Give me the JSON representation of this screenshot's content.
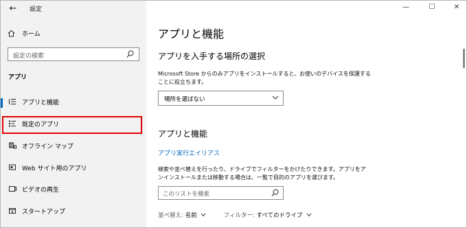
{
  "window": {
    "title": "設定",
    "back_icon": "←",
    "controls": {
      "minimize": "—",
      "maximize": "☐",
      "close": "✕"
    }
  },
  "sidebar": {
    "home": {
      "icon": "home-icon",
      "label": "ホーム"
    },
    "search": {
      "placeholder": "設定の検索"
    },
    "section": "アプリ",
    "items": [
      {
        "icon": "apps-features-icon",
        "label": "アプリと機能",
        "selected": true
      },
      {
        "icon": "default-apps-icon",
        "label": "既定のアプリ",
        "selected": false,
        "highlighted": true
      },
      {
        "icon": "offline-maps-icon",
        "label": "オフライン マップ",
        "selected": false
      },
      {
        "icon": "apps-for-websites-icon",
        "label": "Web サイト用のアプリ",
        "selected": false
      },
      {
        "icon": "video-playback-icon",
        "label": "ビデオの再生",
        "selected": false
      },
      {
        "icon": "startup-icon",
        "label": "スタートアップ",
        "selected": false
      }
    ]
  },
  "main": {
    "page_title": "アプリと機能",
    "install_section": {
      "heading": "アプリを入手する場所の選択",
      "description": "Microsoft Store からのみアプリをインストールすると、お使いのデバイスを保護することに役立ちます。",
      "dropdown_value": "場所を選ばない"
    },
    "features_section": {
      "heading": "アプリと機能",
      "link": "アプリ実行エイリアス",
      "description": "検索や並べ替えを行ったり、ドライブでフィルターをかけたりできます。アプリをアンインストールまたは移動する場合は、一覧で目的のアプリを選びます。",
      "search_placeholder": "このリストを検索",
      "sort_label": "並べ替え:",
      "sort_value": "名前",
      "filter_label": "フィルター:",
      "filter_value": "すべてのドライブ"
    }
  },
  "colors": {
    "accent": "#0067c0",
    "highlight_border": "#e00000",
    "sidebar_bg": "#f2f2f2"
  }
}
